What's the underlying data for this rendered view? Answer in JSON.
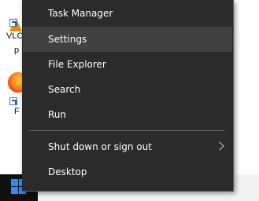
{
  "desktop": {
    "icons": [
      {
        "label": "VLC",
        "sublabel": "p",
        "icon": "vlc-cone-icon"
      },
      {
        "label": "F",
        "icon": "firefox-icon"
      }
    ]
  },
  "menu": {
    "items": [
      {
        "label": "Task Manager"
      },
      {
        "label": "Settings"
      },
      {
        "label": "File Explorer"
      },
      {
        "label": "Search"
      },
      {
        "label": "Run"
      },
      {
        "label": "Shut down or sign out",
        "icon": "chevron-right-icon"
      },
      {
        "label": "Desktop"
      }
    ]
  },
  "taskbar": {
    "start_icon": "windows-start-icon"
  },
  "colors": {
    "menu_bg": "#2b2b2b",
    "hover_bg": "#414141",
    "taskbar_bg": "#101010",
    "windows_blue": "#2f8de4"
  }
}
